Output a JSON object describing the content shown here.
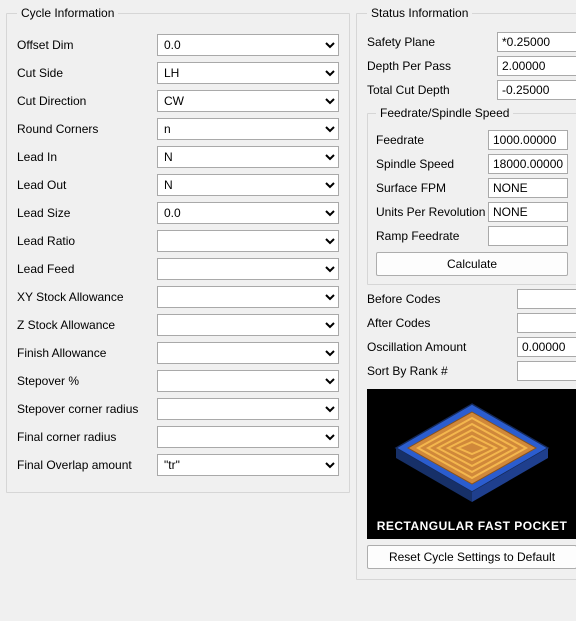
{
  "cycle": {
    "legend": "Cycle Information",
    "rows": [
      {
        "label": "Offset Dim",
        "value": "0.0"
      },
      {
        "label": "Cut Side",
        "value": "LH"
      },
      {
        "label": "Cut Direction",
        "value": "CW"
      },
      {
        "label": "Round Corners",
        "value": "n"
      },
      {
        "label": "Lead In",
        "value": "N"
      },
      {
        "label": "Lead Out",
        "value": "N"
      },
      {
        "label": "Lead Size",
        "value": "0.0"
      },
      {
        "label": "Lead Ratio",
        "value": ""
      },
      {
        "label": "Lead Feed",
        "value": ""
      },
      {
        "label": "XY Stock Allowance",
        "value": ""
      },
      {
        "label": "Z Stock Allowance",
        "value": ""
      },
      {
        "label": "Finish Allowance",
        "value": ""
      },
      {
        "label": "Stepover %",
        "value": ""
      },
      {
        "label": "Stepover corner radius",
        "value": ""
      },
      {
        "label": "Final corner radius",
        "value": ""
      },
      {
        "label": "Final Overlap amount",
        "value": "\"tr\""
      }
    ]
  },
  "status": {
    "legend": "Status Information",
    "safety_plane": {
      "label": "Safety Plane",
      "value": "*0.25000"
    },
    "depth_per_pass": {
      "label": "Depth Per Pass",
      "value": "2.00000"
    },
    "total_cut_depth": {
      "label": "Total Cut Depth",
      "value": "-0.25000"
    },
    "feed_group": {
      "legend": "Feedrate/Spindle Speed",
      "feedrate": {
        "label": "Feedrate",
        "value": "1000.00000"
      },
      "spindle": {
        "label": "Spindle Speed",
        "value": "18000.00000"
      },
      "sfpm": {
        "label": "Surface FPM",
        "value": "NONE"
      },
      "upr": {
        "label": "Units Per Revolution",
        "value": "NONE"
      },
      "ramp": {
        "label": "Ramp Feedrate",
        "value": ""
      },
      "calc": "Calculate"
    },
    "before_codes": {
      "label": "Before Codes",
      "value": ""
    },
    "after_codes": {
      "label": "After Codes",
      "value": ""
    },
    "osc_amount": {
      "label": "Oscillation Amount",
      "value": "0.00000"
    },
    "sort_rank": {
      "label": "Sort By Rank #",
      "value": ""
    },
    "img_caption": "RECTANGULAR FAST POCKET",
    "reset_btn": "Reset Cycle Settings to Default"
  }
}
